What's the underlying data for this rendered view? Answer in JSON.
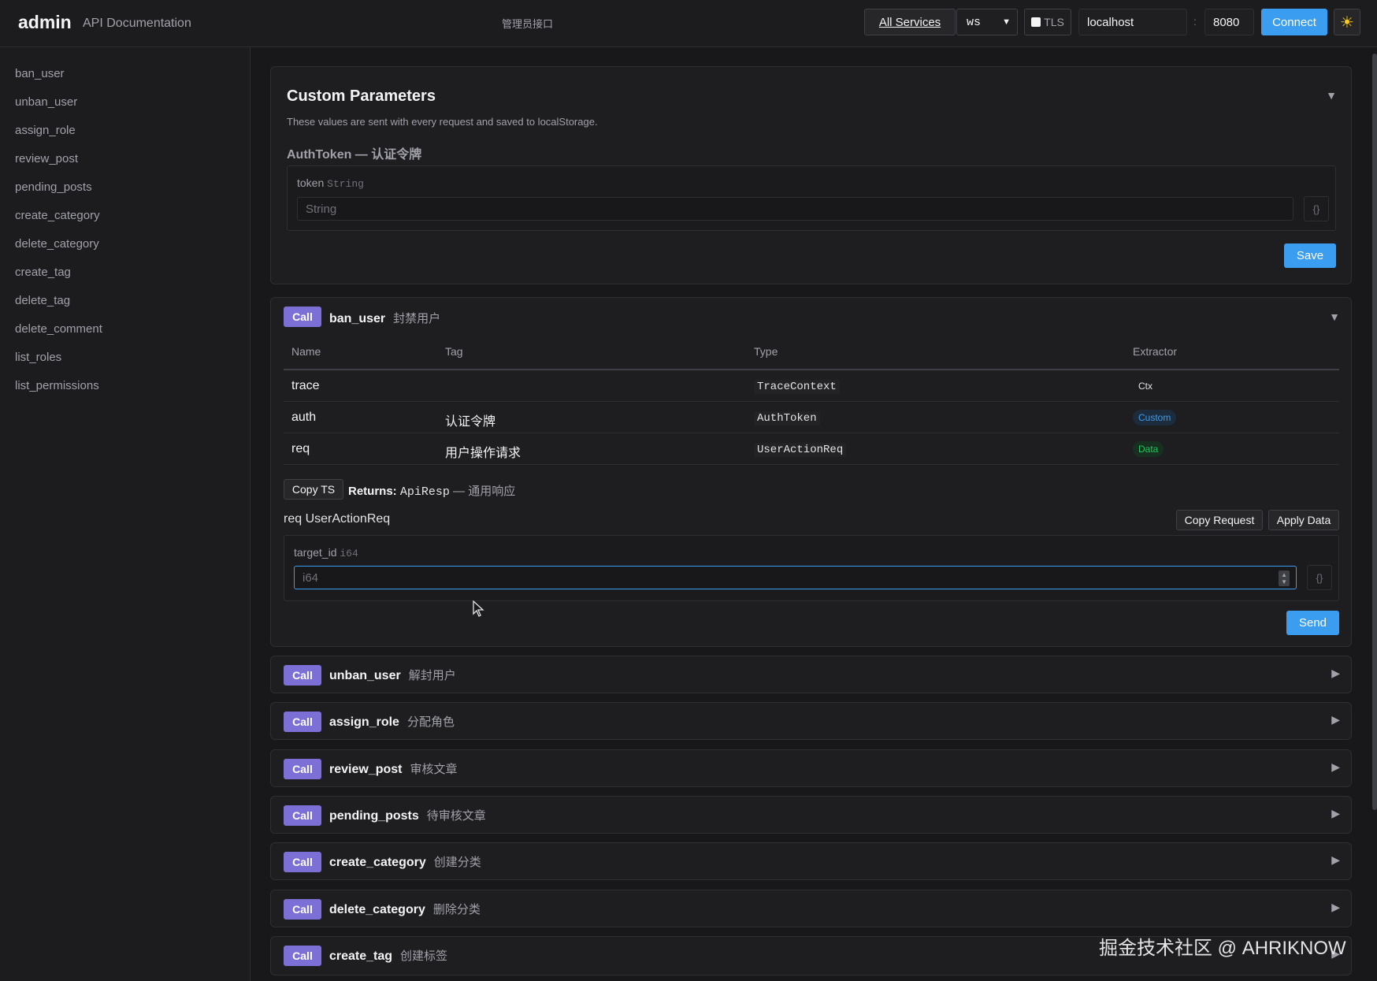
{
  "header": {
    "app_title": "admin",
    "app_subtitle": "API Documentation",
    "service_desc": "管理员接口",
    "all_services_label": "All Services",
    "protocol_value": "ws",
    "tls_label": "TLS",
    "host_value": "localhost",
    "colon": ":",
    "port_value": "8080",
    "connect_label": "Connect",
    "theme_icon": "☀"
  },
  "sidebar": {
    "items": [
      {
        "label": "ban_user"
      },
      {
        "label": "unban_user"
      },
      {
        "label": "assign_role"
      },
      {
        "label": "review_post"
      },
      {
        "label": "pending_posts"
      },
      {
        "label": "create_category"
      },
      {
        "label": "delete_category"
      },
      {
        "label": "create_tag"
      },
      {
        "label": "delete_tag"
      },
      {
        "label": "delete_comment"
      },
      {
        "label": "list_roles"
      },
      {
        "label": "list_permissions"
      }
    ]
  },
  "custom_params": {
    "title": "Custom Parameters",
    "collapse_icon": "▼",
    "description": "These values are sent with every request and saved to localStorage.",
    "section_title": "AuthToken — 认证令牌",
    "field_name": "token",
    "field_type": "String",
    "input_placeholder": "String",
    "json_button": "{}",
    "save_label": "Save"
  },
  "expanded_op": {
    "badge": "Call",
    "name": "ban_user",
    "desc": "封禁用户",
    "toggle_icon": "▼",
    "columns": [
      "Name",
      "Tag",
      "Type",
      "Extractor"
    ],
    "rows": [
      {
        "name": "trace",
        "tag": "",
        "type": "TraceContext",
        "extractor": "Ctx"
      },
      {
        "name": "auth",
        "tag": "认证令牌",
        "type": "AuthToken",
        "extractor": "Custom"
      },
      {
        "name": "req",
        "tag": "用户操作请求",
        "type": "UserActionReq",
        "extractor": "Data"
      }
    ],
    "copy_ts_label": "Copy TS",
    "returns_label": "Returns:",
    "returns_type": "ApiResp",
    "returns_desc": "— 通用响应",
    "req_title": "req UserActionReq",
    "copy_request_label": "Copy Request",
    "apply_data_label": "Apply Data",
    "req_field_name": "target_id",
    "req_field_type": "i64",
    "req_input_placeholder": "i64",
    "json_button": "{}",
    "send_label": "Send"
  },
  "operations": [
    {
      "badge": "Call",
      "name": "unban_user",
      "desc": "解封用户",
      "toggle_icon": "▶"
    },
    {
      "badge": "Call",
      "name": "assign_role",
      "desc": "分配角色",
      "toggle_icon": "▶"
    },
    {
      "badge": "Call",
      "name": "review_post",
      "desc": "审核文章",
      "toggle_icon": "▶"
    },
    {
      "badge": "Call",
      "name": "pending_posts",
      "desc": "待审核文章",
      "toggle_icon": "▶"
    },
    {
      "badge": "Call",
      "name": "create_category",
      "desc": "创建分类",
      "toggle_icon": "▶"
    },
    {
      "badge": "Call",
      "name": "delete_category",
      "desc": "删除分类",
      "toggle_icon": "▶"
    },
    {
      "badge": "Call",
      "name": "create_tag",
      "desc": "创建标签",
      "toggle_icon": "▶"
    }
  ],
  "watermark": "掘金技术社区 @ AHRIKNOW",
  "colors": {
    "accent": "#3b9df0",
    "call_badge": "#7c6fd6",
    "custom_pill": "#3b9df0",
    "data_pill": "#22c55e"
  }
}
